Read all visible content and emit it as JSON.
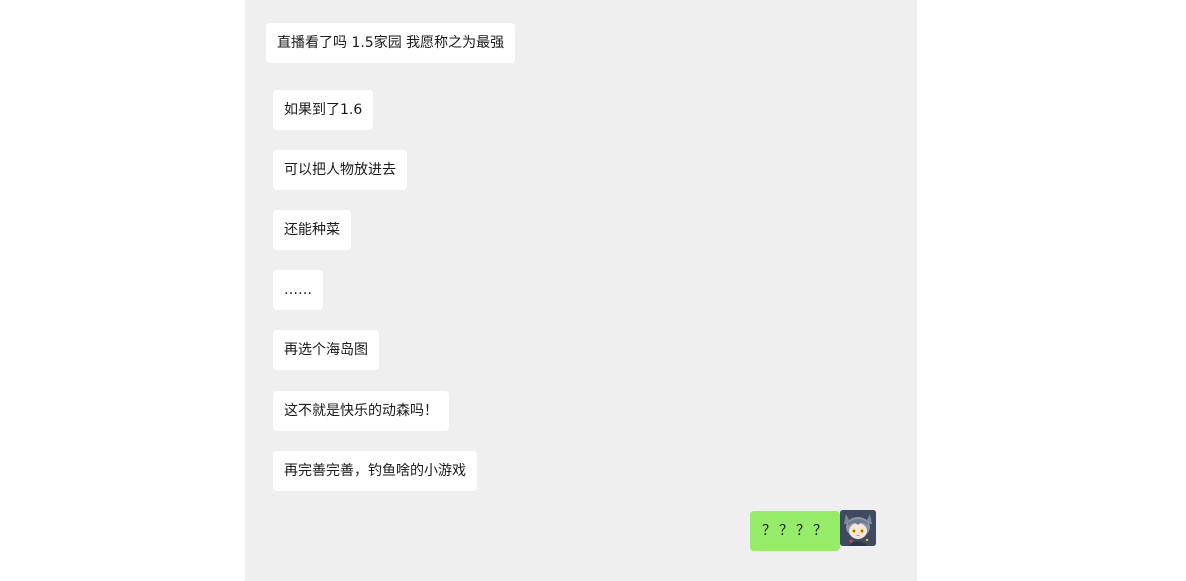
{
  "messages": [
    {
      "text": "直播看了吗 1.5家园 我愿称之为最强",
      "side": "left"
    },
    {
      "text": "如果到了1.6",
      "side": "left"
    },
    {
      "text": "可以把人物放进去",
      "side": "left"
    },
    {
      "text": "还能种菜",
      "side": "left"
    },
    {
      "text": "……",
      "side": "left"
    },
    {
      "text": "再选个海岛图",
      "side": "left"
    },
    {
      "text": "这不就是快乐的动森吗！",
      "side": "left"
    },
    {
      "text": "再完善完善，钓鱼啥的小游戏",
      "side": "left"
    },
    {
      "text": "？？？？",
      "side": "right"
    }
  ],
  "colors": {
    "chat_background": "#efefef",
    "incoming_bubble": "#ffffff",
    "outgoing_bubble": "#95ec69"
  },
  "icons": {
    "self_avatar": "anime-character-avatar-icon"
  }
}
